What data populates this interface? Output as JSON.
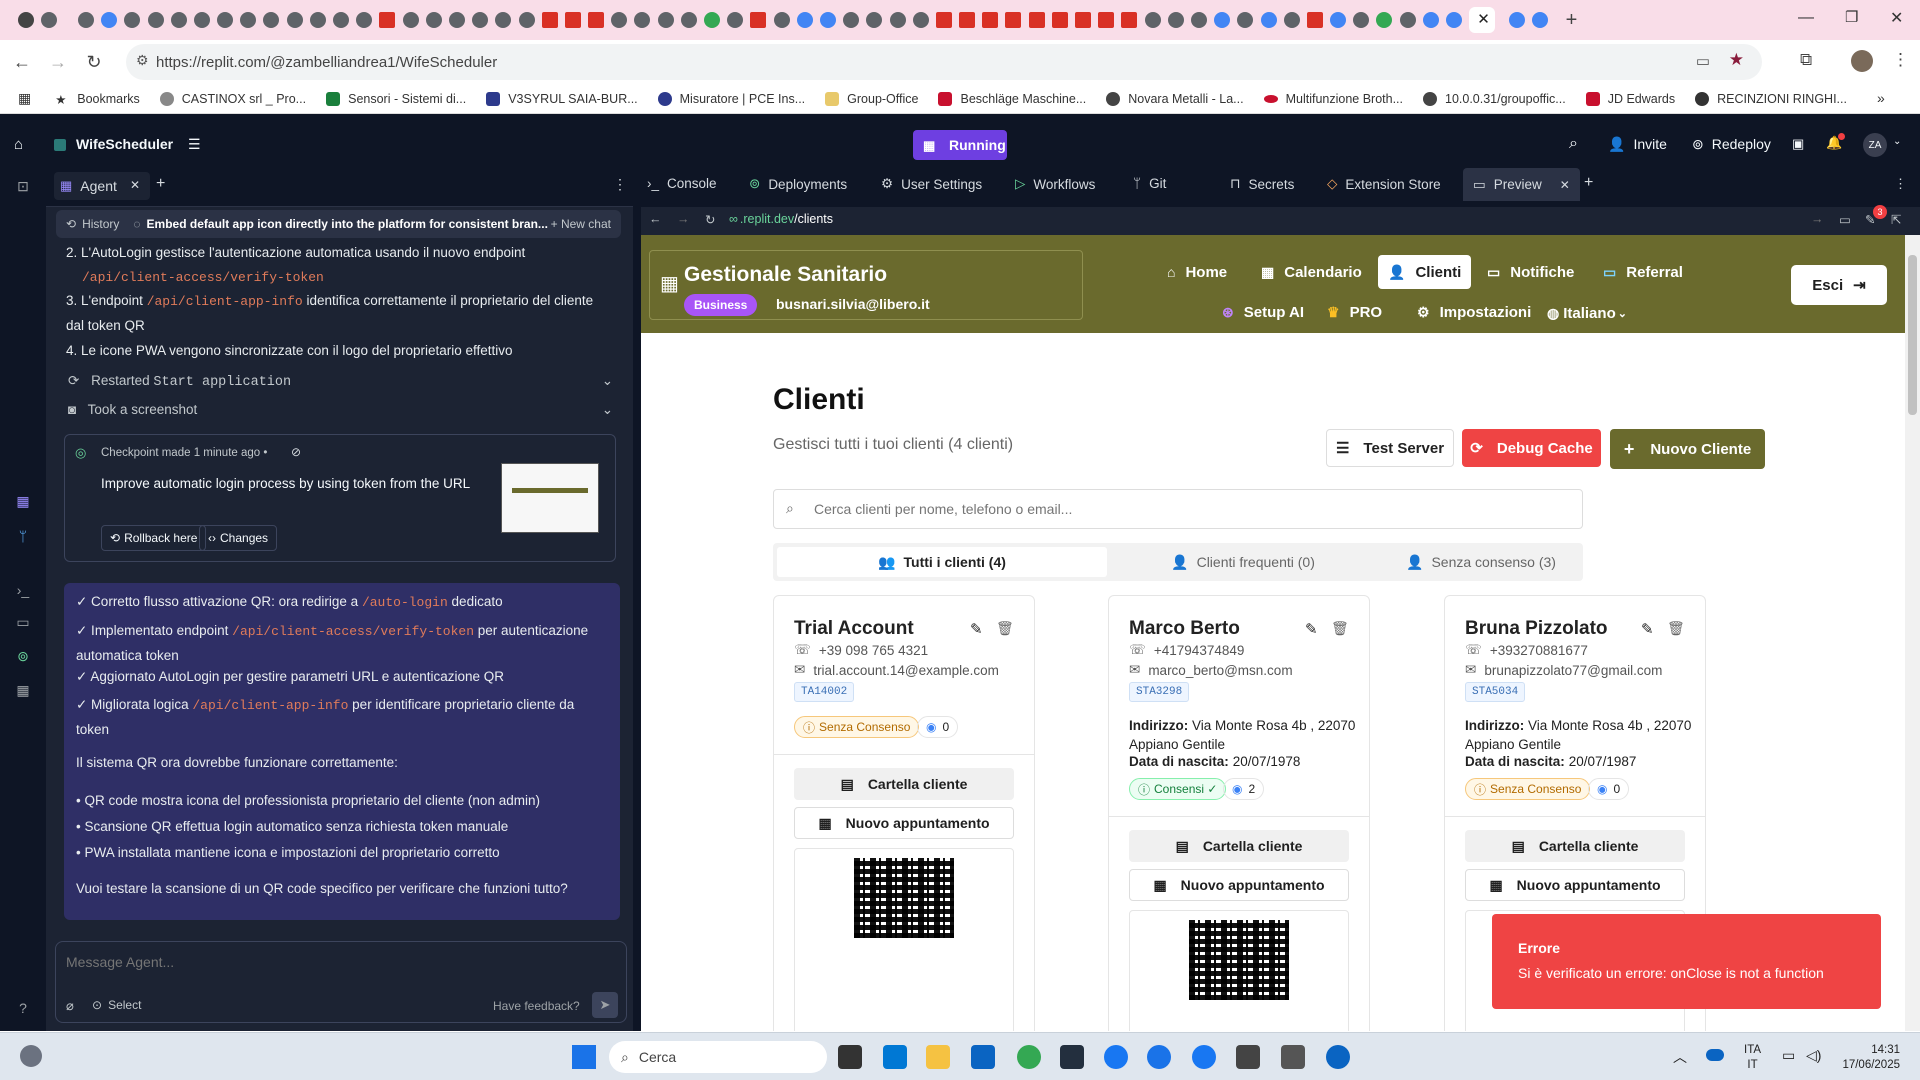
{
  "browser": {
    "url": "https://replit.com/@zambelliandrea1/WifeScheduler",
    "bookmarks": [
      "Bookmarks",
      "CASTINOX srl _ Pro...",
      "Sensori - Sistemi di...",
      "V3SYRUL SAIA-BUR...",
      "Misuratore | PCE Ins...",
      "Group-Office",
      "Beschläge Maschine...",
      "Novara Metalli - La...",
      "Multifunzione Broth...",
      "10.0.0.31/groupoffic...",
      "JD Edwards",
      "RECINZIONI RINGHI..."
    ]
  },
  "replit": {
    "project_name": "WifeScheduler",
    "status": "Running",
    "invite": "Invite",
    "redeploy": "Redeploy",
    "avatar": "ZA"
  },
  "agent": {
    "tab_label": "Agent",
    "history": "History",
    "thread_title": "Embed default app icon directly into the platform for consistent bran...",
    "new_chat": "+ New chat",
    "steps": [
      {
        "n": "2.",
        "before": "L'AutoLogin gestisce l'autenticazione automatica usando il nuovo endpoint",
        "code": "/api/client-access/verify-token",
        "after": ""
      },
      {
        "n": "3.",
        "before": "L'endpoint",
        "code": "/api/client-app-info",
        "after": "identifica correttamente il proprietario del cliente dal token QR"
      },
      {
        "n": "4.",
        "before": "Le icone PWA vengono sincronizzate con il logo del proprietario effettivo",
        "code": "",
        "after": ""
      }
    ],
    "restarted": "Restarted",
    "restarted_code": "Start application",
    "screenshot": "Took a screenshot",
    "checkpoint_meta": "Checkpoint made 1 minute ago •",
    "checkpoint_text": "Improve automatic login process by using token from the URL",
    "rollback": "Rollback here",
    "changes": "Changes",
    "message": {
      "checks": [
        {
          "before": "✓ Corretto flusso attivazione QR: ora redirige a",
          "code": "/auto-login",
          "after": "dedicato"
        },
        {
          "before": "✓ Implementato endpoint",
          "code": "/api/client-access/verify-token",
          "after": "per autenticazione automatica token"
        },
        {
          "before": "✓ Aggiornato AutoLogin per gestire parametri URL e autenticazione QR",
          "code": "",
          "after": ""
        },
        {
          "before": "✓ Migliorata logica",
          "code": "/api/client-app-info",
          "after": "per identificare proprietario cliente da token"
        }
      ],
      "summary": "Il sistema QR ora dovrebbe funzionare correttamente:",
      "bullets": [
        "QR code mostra icona del professionista proprietario del cliente (non admin)",
        "Scansione QR effettua login automatico senza richiesta token manuale",
        "PWA installata mantiene icona e impostazioni del proprietario corretto"
      ],
      "question": "Vuoi testare la scansione di un QR code specifico per verificare che funzioni tutto?"
    },
    "composer_placeholder": "Message Agent...",
    "select": "Select",
    "feedback": "Have feedback?"
  },
  "workspace_tabs": [
    "Console",
    "Deployments",
    "User Settings",
    "Workflows",
    "Git",
    "Secrets",
    "Extension Store",
    "Preview"
  ],
  "preview": {
    "url_prefix": ".replit.dev",
    "url_path": "/clients",
    "badge_count": "3"
  },
  "app": {
    "title": "Gestionale Sanitario",
    "plan": "Business",
    "user_email": "busnari.silvia@libero.it",
    "nav": [
      "Home",
      "Calendario",
      "Clienti",
      "Notifiche",
      "Referral"
    ],
    "nav2": [
      "Setup AI",
      "PRO",
      "Impostazioni",
      "Italiano"
    ],
    "logout": "Esci",
    "page_title": "Clienti",
    "page_subtitle": "Gestisci tutti i tuoi clienti (4 clienti)",
    "btn_test": "Test Server",
    "btn_debug": "Debug Cache",
    "btn_new": "Nuovo Cliente",
    "search_placeholder": "Cerca clienti per nome, telefono o email...",
    "filters": [
      "Tutti i clienti (4)",
      "Clienti frequenti (0)",
      "Senza consenso (3)"
    ],
    "clients": [
      {
        "name": "Trial Account",
        "phone": "+39 098 765 4321",
        "email": "trial.account.14@example.com",
        "code": "TA14002",
        "address_label": "",
        "address": "",
        "dob_label": "",
        "dob": "",
        "consent": "Senza Consenso",
        "views": "0"
      },
      {
        "name": "Marco Berto",
        "phone": "+41794374849",
        "email": "marco_berto@msn.com",
        "code": "STA3298",
        "address_label": "Indirizzo:",
        "address": "Via Monte Rosa 4b , 22070 Appiano Gentile",
        "dob_label": "Data di nascita:",
        "dob": "20/07/1978",
        "consent": "Consensi ✓",
        "views": "2"
      },
      {
        "name": "Bruna Pizzolato",
        "phone": "+393270881677",
        "email": "brunapizzolato77@gmail.com",
        "code": "STA5034",
        "address_label": "Indirizzo:",
        "address": "Via Monte Rosa 4b , 22070 Appiano Gentile",
        "dob_label": "Data di nascita:",
        "dob": "20/07/1987",
        "consent": "Senza Consenso",
        "views": "0"
      }
    ],
    "card_btn_folder": "Cartella cliente",
    "card_btn_appointment": "Nuovo appuntamento",
    "toast_title": "Errore",
    "toast_msg": "Si è verificato un errore: onClose is not a function"
  },
  "taskbar": {
    "search": "Cerca",
    "lang1": "ITA",
    "lang2": "IT",
    "time": "14:31",
    "date": "17/06/2025"
  },
  "colors": {
    "header_olive": "#6a6a2d",
    "replit_dark": "#0e1525",
    "running_purple": "#6e3fe1",
    "debug_red": "#ef4444",
    "toast_red": "#ef4444"
  }
}
